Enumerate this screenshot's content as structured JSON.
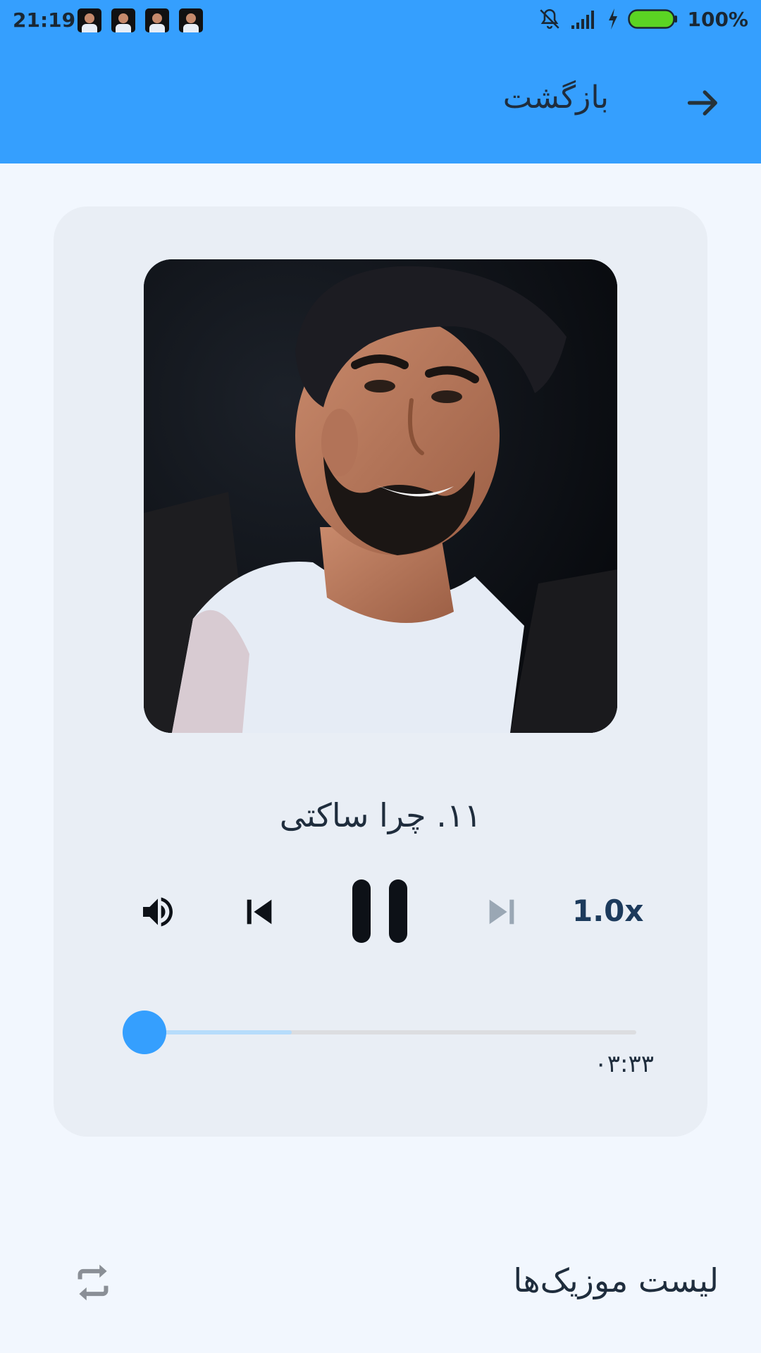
{
  "status_bar": {
    "time": "21:19",
    "battery_percent": "100%"
  },
  "header": {
    "back_label": "بازگشت"
  },
  "player": {
    "track_title": "۱۱. چرا ساکتی",
    "speed": "1.0x",
    "duration": "۰۳:۳۳",
    "playback_progress": 0,
    "buffered_progress": 0.3
  },
  "footer": {
    "playlist_label": "لیست موزیک‌ها"
  },
  "colors": {
    "accent": "#359ffe",
    "card": "#e9eef5",
    "background": "#f2f7fe",
    "text": "#1f2d3d"
  },
  "icons": [
    "notifications-off-icon",
    "signal-icon",
    "charging-icon",
    "battery-icon",
    "arrow-right-icon",
    "volume-icon",
    "skip-previous-icon",
    "pause-icon",
    "skip-next-icon",
    "repeat-icon"
  ]
}
